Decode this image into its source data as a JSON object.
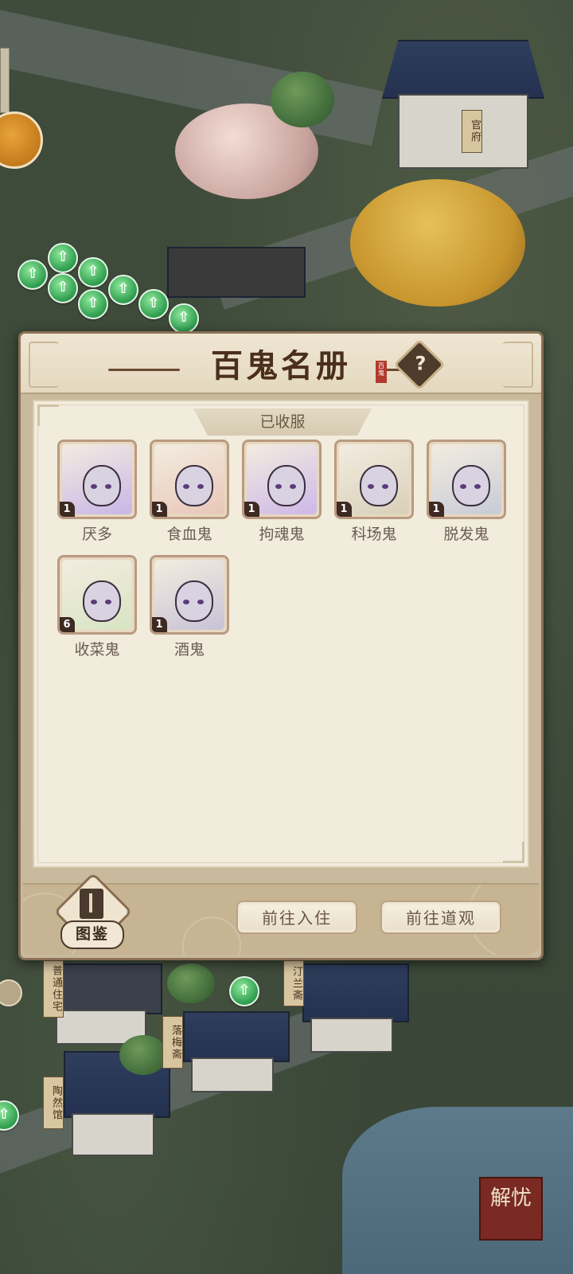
{
  "map": {
    "signs": [
      "官府",
      "普通住宅",
      "汀兰斋",
      "落梅斋",
      "陶然馆"
    ],
    "stamp_text": "解忧"
  },
  "dialog": {
    "title": "百鬼名册",
    "seal_text": "百鬼",
    "help_symbol": "?",
    "section_label": "已收服",
    "ghosts": [
      {
        "name": "厌多",
        "level": "1",
        "color": "#c9b6e6"
      },
      {
        "name": "食血鬼",
        "level": "1",
        "color": "#e8c7b8"
      },
      {
        "name": "拘魂鬼",
        "level": "1",
        "color": "#cdb8e8"
      },
      {
        "name": "科场鬼",
        "level": "1",
        "color": "#d8d0b8"
      },
      {
        "name": "脱发鬼",
        "level": "1",
        "color": "#c8cbd6"
      },
      {
        "name": "收菜鬼",
        "level": "6",
        "color": "#d7e4c3"
      },
      {
        "name": "酒鬼",
        "level": "1",
        "color": "#c8c3d6"
      }
    ],
    "codex_label": "图鉴",
    "goto_residence_label": "前往入住",
    "goto_temple_label": "前往道观"
  }
}
